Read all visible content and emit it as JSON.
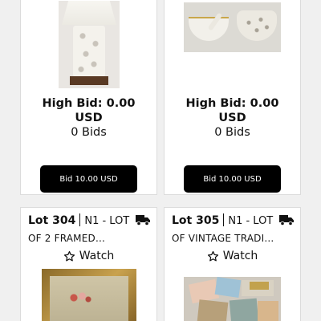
{
  "lots": [
    {
      "image": "table-lamp-photo",
      "high_bid_line1": "High Bid: 0.00",
      "high_bid_line2": "USD",
      "bids_count": "0 Bids",
      "bid_button": "Bid 10.00 USD"
    },
    {
      "image": "porcelain-bowls-photo",
      "high_bid_line1": "High Bid: 0.00",
      "high_bid_line2": "USD",
      "bids_count": "0 Bids",
      "bid_button": "Bid 10.00 USD"
    },
    {
      "lot_number": "Lot 304",
      "category": "N1 - LOT",
      "title_line2": "OF 2 FRAMED...",
      "watch_label": "Watch",
      "image": "framed-painting-photo",
      "shipping_icon": "truck-icon"
    },
    {
      "lot_number": "Lot 305",
      "category": "N1 - LOT",
      "title_line2": "OF VINTAGE TRADI...",
      "watch_label": "Watch",
      "image": "trading-cards-photo",
      "shipping_icon": "truck-icon"
    }
  ],
  "colors": {
    "button_bg": "#000000",
    "button_text": "#ffffff",
    "page_bg": "#f0f0f0",
    "card_border": "#dcdcdc"
  }
}
